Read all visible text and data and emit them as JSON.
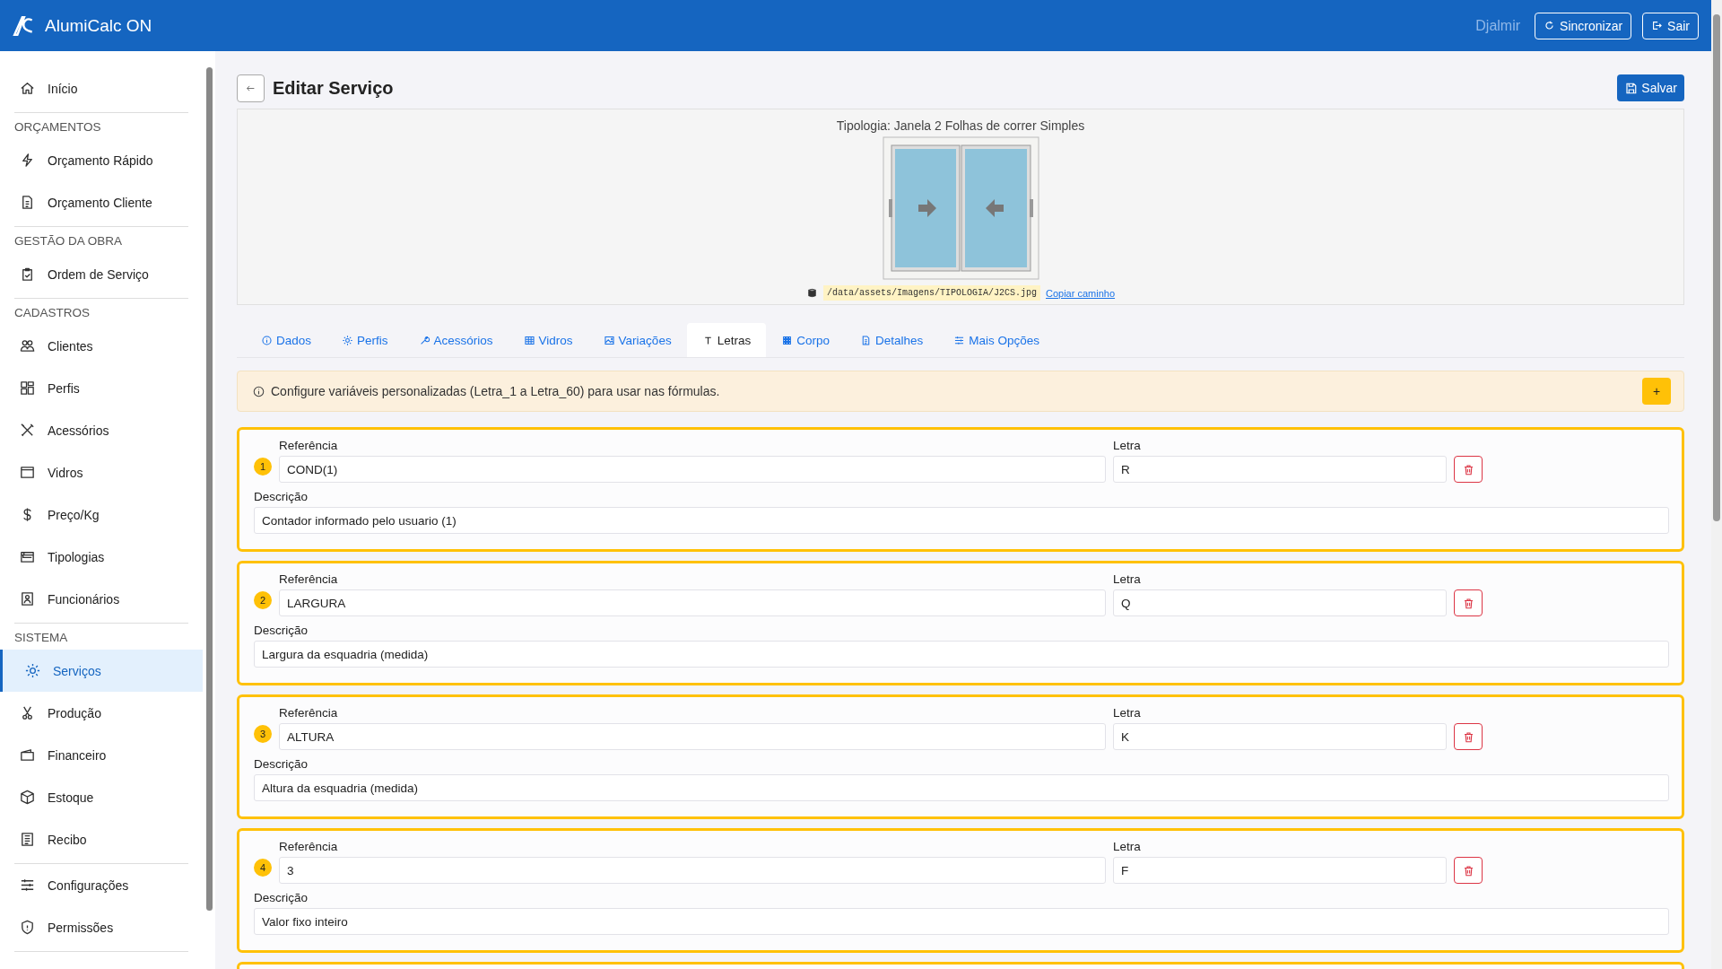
{
  "header": {
    "app_name": "AlumiCalc ON",
    "user": "Djalmir",
    "buttons": [
      {
        "kind": "sync",
        "label": "Sincronizar"
      },
      {
        "kind": "exit",
        "label": "Sair"
      }
    ]
  },
  "sidebar": {
    "sections": [
      {
        "items": [
          {
            "label": "Início",
            "selected": false
          }
        ]
      },
      {
        "header": "ORÇAMENTOS",
        "items": [
          {
            "label": "Orçamento Rápido",
            "selected": false
          },
          {
            "label": "Orçamento Cliente",
            "selected": false
          }
        ]
      },
      {
        "header": "GESTÃO DA OBRA",
        "items": [
          {
            "label": "Ordem de Serviço",
            "selected": false
          }
        ]
      },
      {
        "header": "CADASTROS",
        "items": [
          {
            "label": "Clientes",
            "selected": false
          },
          {
            "label": "Perfis",
            "selected": false
          },
          {
            "label": "Acessórios",
            "selected": false
          },
          {
            "label": "Vidros",
            "selected": false
          },
          {
            "label": "Preço/Kg",
            "selected": false
          },
          {
            "label": "Tipologias",
            "selected": false
          },
          {
            "label": "Funcionários",
            "selected": false
          }
        ]
      },
      {
        "header": "SISTEMA",
        "items": [
          {
            "label": "Serviços",
            "selected": true
          },
          {
            "label": "Produção",
            "selected": false
          },
          {
            "label": "Financeiro",
            "selected": false
          },
          {
            "label": "Estoque",
            "selected": false
          },
          {
            "label": "Recibo",
            "selected": false
          }
        ]
      },
      {
        "items": [
          {
            "label": "Configurações",
            "selected": false
          },
          {
            "label": "Permissões",
            "selected": false
          }
        ]
      }
    ]
  },
  "page": {
    "title": "Editar Serviço",
    "save_label": "Salvar"
  },
  "preview": {
    "typology": "Tipologia: Janela 2 Folhas de correr Simples",
    "path": "/data/assets/Imagens/TIPOLOGIA/J2CS.jpg",
    "copy_link": "Copiar caminho"
  },
  "tabs": [
    {
      "label": "Dados",
      "selected": false
    },
    {
      "label": "Perfis",
      "selected": false
    },
    {
      "label": "Acessórios",
      "selected": false
    },
    {
      "label": "Vidros",
      "selected": false
    },
    {
      "label": "Variações",
      "selected": false
    },
    {
      "label": "Letras",
      "selected": true
    },
    {
      "label": "Corpo",
      "selected": false
    },
    {
      "label": "Detalhes",
      "selected": false
    },
    {
      "label": "Mais Opções",
      "selected": false
    }
  ],
  "alert": {
    "text": "Configure variáveis personalizadas (Letra_1 a Letra_60) para usar nas fórmulas.",
    "add_label": "+"
  },
  "letters": [
    {
      "number": "1",
      "reference_label": "Referência",
      "reference": "COND(1)",
      "letter_label": "Letra",
      "letter": "R",
      "description_label": "Descrição",
      "description": "Contador informado pelo usuario (1)"
    },
    {
      "number": "2",
      "reference_label": "Referência",
      "reference": "LARGURA",
      "letter_label": "Letra",
      "letter": "Q",
      "description_label": "Descrição",
      "description": "Largura da esquadria (medida)"
    },
    {
      "number": "3",
      "reference_label": "Referência",
      "reference": "ALTURA",
      "letter_label": "Letra",
      "letter": "K",
      "description_label": "Descrição",
      "description": "Altura da esquadria (medida)"
    },
    {
      "number": "4",
      "reference_label": "Referência",
      "reference": "3",
      "letter_label": "Letra",
      "letter": "F",
      "description_label": "Descrição",
      "description": "Valor fixo inteiro"
    }
  ],
  "more_cards_below": true
}
